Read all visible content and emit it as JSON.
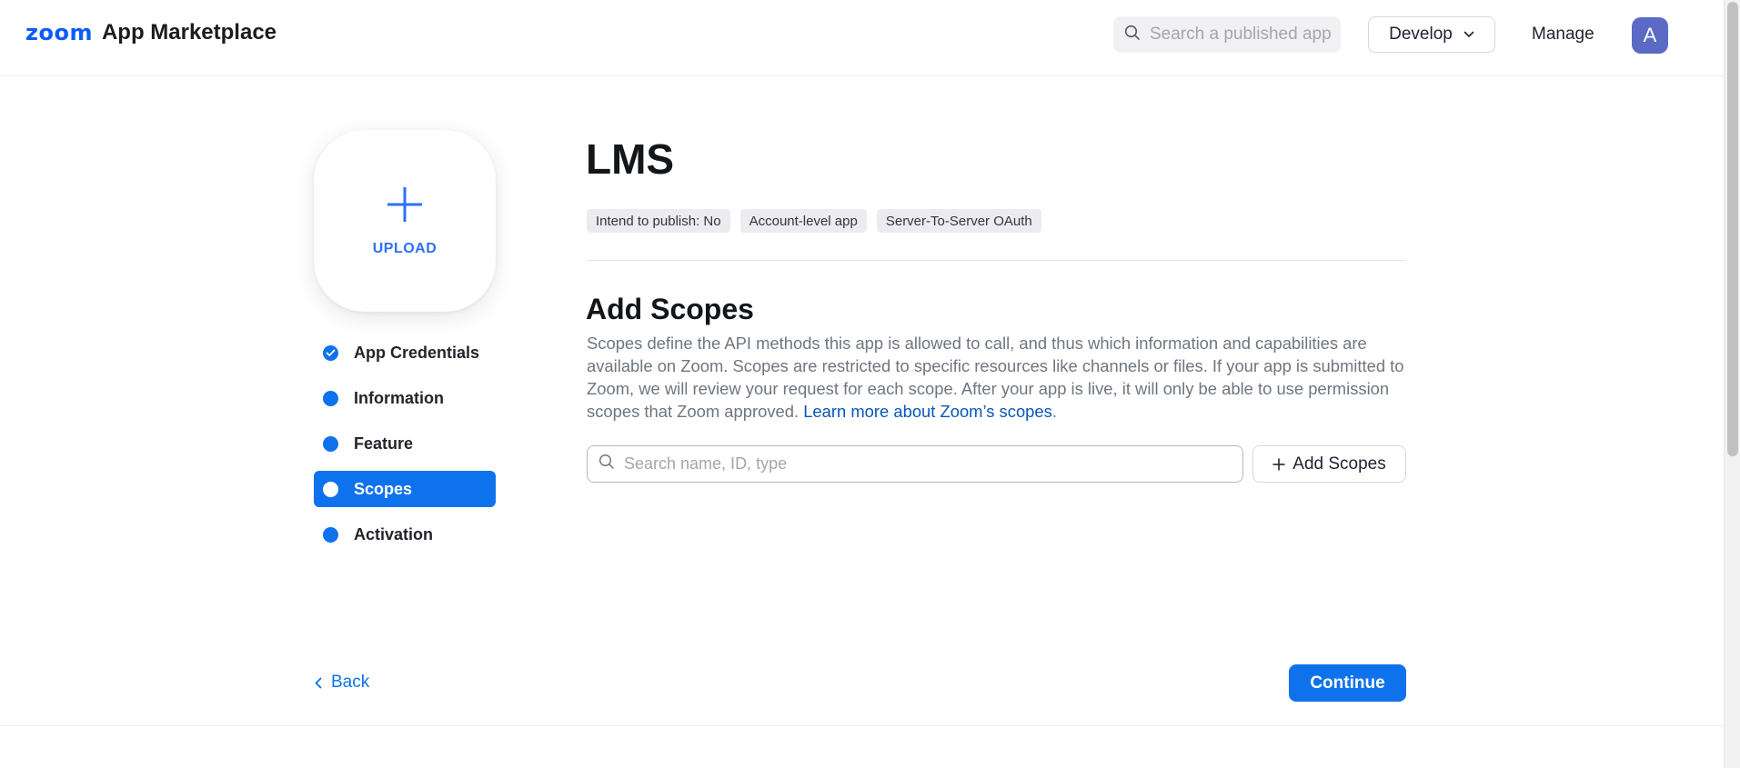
{
  "header": {
    "brand_zoom": "zoom",
    "brand_rest": "App Marketplace",
    "search_placeholder": "Search a published app",
    "develop_label": "Develop",
    "manage_label": "Manage",
    "avatar_initial": "A"
  },
  "upload": {
    "label": "UPLOAD"
  },
  "sidebar": {
    "items": [
      {
        "label": "App Credentials",
        "state": "completed"
      },
      {
        "label": "Information",
        "state": "pending"
      },
      {
        "label": "Feature",
        "state": "pending"
      },
      {
        "label": "Scopes",
        "state": "active"
      },
      {
        "label": "Activation",
        "state": "pending"
      }
    ]
  },
  "app": {
    "title": "LMS",
    "tags": [
      "Intend to publish: No",
      "Account-level app",
      "Server-To-Server OAuth"
    ]
  },
  "scopes": {
    "title": "Add Scopes",
    "description": "Scopes define the API methods this app is allowed to call, and thus which information and capabilities are available on Zoom. Scopes are restricted to specific resources like channels or files. If your app is submitted to Zoom, we will review your request for each scope. After your app is live, it will only be able to use permission scopes that Zoom approved. ",
    "learn_more": "Learn more about Zoom’s scopes",
    "learn_more_suffix": ".",
    "search_placeholder": "Search name, ID, type",
    "add_button": "Add Scopes"
  },
  "footer": {
    "back_label": "Back",
    "continue_label": "Continue"
  },
  "colors": {
    "accent": "#0e72ed",
    "brand": "#0b5cff",
    "avatar": "#5a6ac5"
  },
  "icons": {
    "search": "search-icon",
    "chevron_down": "chevron-down-icon",
    "plus": "plus-icon",
    "check": "check-icon",
    "chevron_left": "chevron-left-icon"
  }
}
